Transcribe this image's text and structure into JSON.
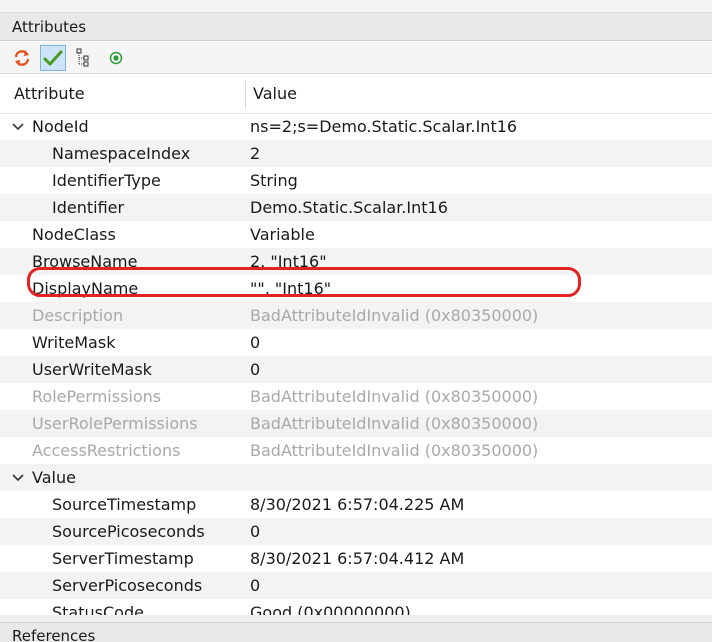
{
  "panel": {
    "title": "Attributes"
  },
  "toolbar": {
    "buttons": [
      {
        "icon": "refresh-icon"
      },
      {
        "icon": "checkmark-icon",
        "active": true
      },
      {
        "icon": "tree-icon"
      },
      {
        "icon": "record-icon"
      }
    ]
  },
  "columns": {
    "attribute": "Attribute",
    "value": "Value"
  },
  "rows": [
    {
      "name": "NodeId",
      "value": "ns=2;s=Demo.Static.Scalar.Int16",
      "level": 0,
      "expanded": true,
      "dim": false
    },
    {
      "name": "NamespaceIndex",
      "value": "2",
      "level": 1,
      "dim": false
    },
    {
      "name": "IdentifierType",
      "value": "String",
      "level": 1,
      "dim": false
    },
    {
      "name": "Identifier",
      "value": "Demo.Static.Scalar.Int16",
      "level": 1,
      "dim": false
    },
    {
      "name": "NodeClass",
      "value": "Variable",
      "level": 0,
      "dim": false
    },
    {
      "name": "BrowseName",
      "value": "2, \"Int16\"",
      "level": 0,
      "dim": false
    },
    {
      "name": "DisplayName",
      "value": "\"\", \"Int16\"",
      "level": 0,
      "dim": false
    },
    {
      "name": "Description",
      "value": "BadAttributeIdInvalid (0x80350000)",
      "level": 0,
      "dim": true
    },
    {
      "name": "WriteMask",
      "value": "0",
      "level": 0,
      "dim": false
    },
    {
      "name": "UserWriteMask",
      "value": "0",
      "level": 0,
      "dim": false
    },
    {
      "name": "RolePermissions",
      "value": "BadAttributeIdInvalid (0x80350000)",
      "level": 0,
      "dim": true
    },
    {
      "name": "UserRolePermissions",
      "value": "BadAttributeIdInvalid (0x80350000)",
      "level": 0,
      "dim": true
    },
    {
      "name": "AccessRestrictions",
      "value": "BadAttributeIdInvalid (0x80350000)",
      "level": 0,
      "dim": true
    },
    {
      "name": "Value",
      "value": "",
      "level": 0,
      "expanded": true,
      "dim": false
    },
    {
      "name": "SourceTimestamp",
      "value": "8/30/2021 6:57:04.225 AM",
      "level": 1,
      "dim": false
    },
    {
      "name": "SourcePicoseconds",
      "value": "0",
      "level": 1,
      "dim": false
    },
    {
      "name": "ServerTimestamp",
      "value": "8/30/2021 6:57:04.412 AM",
      "level": 1,
      "dim": false
    },
    {
      "name": "ServerPicoseconds",
      "value": "0",
      "level": 1,
      "dim": false
    },
    {
      "name": "StatusCode",
      "value": "Good (0x00000000)",
      "level": 1,
      "dim": false
    }
  ],
  "highlight": {
    "row": "Identifier",
    "color": "#e32222"
  },
  "bottom_panel": {
    "title": "References"
  }
}
